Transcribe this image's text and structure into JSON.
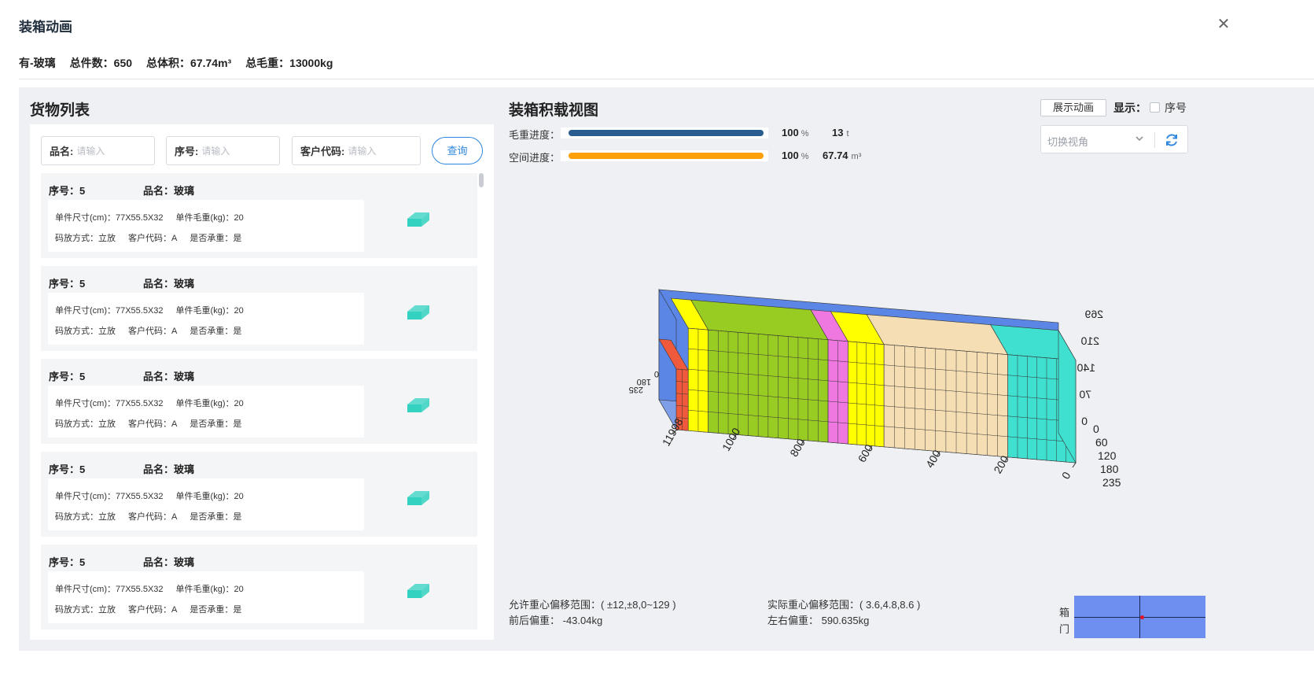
{
  "modal": {
    "title": "装箱动画",
    "close_glyph": "✕"
  },
  "summary": {
    "cargo": "有-玻璃",
    "total_count": "总件数：650",
    "total_volume": "总体积：67.74m³",
    "total_weight": "总毛重：13000kg"
  },
  "cargo_list": {
    "title": "货物列表",
    "filters": [
      {
        "label": "品名:",
        "placeholder": "请输入"
      },
      {
        "label": "序号:",
        "placeholder": "请输入"
      },
      {
        "label": "客户代码:",
        "placeholder": "请输入"
      }
    ],
    "query_label": "查询",
    "items": [
      {
        "seq": "序号：5",
        "name": "品名：玻璃",
        "size": "单件尺寸(cm)：77X55.5X32",
        "weight": "单件毛重(kg)：20",
        "placement": "码放方式：立放",
        "customer": "客户代码：A",
        "bearing": "是否承重：是",
        "icon": "box-icon"
      },
      {
        "seq": "序号：5",
        "name": "品名：玻璃",
        "size": "单件尺寸(cm)：77X55.5X32",
        "weight": "单件毛重(kg)：20",
        "placement": "码放方式：立放",
        "customer": "客户代码：A",
        "bearing": "是否承重：是",
        "icon": "box-icon"
      },
      {
        "seq": "序号：5",
        "name": "品名：玻璃",
        "size": "单件尺寸(cm)：77X55.5X32",
        "weight": "单件毛重(kg)：20",
        "placement": "码放方式：立放",
        "customer": "客户代码：A",
        "bearing": "是否承重：是",
        "icon": "box-icon"
      },
      {
        "seq": "序号：5",
        "name": "品名：玻璃",
        "size": "单件尺寸(cm)：77X55.5X32",
        "weight": "单件毛重(kg)：20",
        "placement": "码放方式：立放",
        "customer": "客户代码：A",
        "bearing": "是否承重：是",
        "icon": "box-icon"
      },
      {
        "seq": "序号：5",
        "name": "品名：玻璃",
        "size": "单件尺寸(cm)：77X55.5X32",
        "weight": "单件毛重(kg)：20",
        "placement": "码放方式：立放",
        "customer": "客户代码：A",
        "bearing": "是否承重：是",
        "icon": "box-icon"
      }
    ],
    "box_color": "#33d1c0"
  },
  "loading_view": {
    "title": "装箱积载视图",
    "weight_progress": {
      "label": "毛重进度：",
      "percent": 100,
      "percent_text": "100",
      "percent_unit": "%",
      "value": "13",
      "unit": "t",
      "color": "#2a5d8f"
    },
    "space_progress": {
      "label": "空间进度：",
      "percent": 100,
      "percent_text": "100",
      "percent_unit": "%",
      "value": "67.74",
      "unit": "m³",
      "color": "#ff9f0a"
    },
    "animate_button": "展示动画",
    "show_label": "显示：",
    "seq_checkbox_label": "序号",
    "seq_checked": false,
    "view_select_placeholder": "切换视角",
    "length_ticks": [
      "0",
      "200",
      "400",
      "600",
      "800",
      "1000",
      "11998"
    ],
    "width_ticks": [
      "0",
      "60",
      "120",
      "180",
      "235"
    ],
    "height_ticks": [
      "0",
      "70",
      "140",
      "210",
      "269"
    ],
    "back_ticks": [
      "235",
      "180",
      "0"
    ],
    "colors": {
      "container": "#5b86e5",
      "red": "#ef5a3c",
      "yellow": "#ffff00",
      "green": "#99cc22",
      "pink": "#ee77e0",
      "tan": "#f5deb3",
      "cyan": "#40e0d0"
    }
  },
  "cog": {
    "allowed_label": "允许重心偏移范围：( ±12,±8,0~129 )",
    "actual_label": "实际重心偏移范围：( 3.6,4.8,8.6 )",
    "front_back": "前后偏重：  -43.04kg",
    "left_right": "左右偏重：  590.635kg",
    "door_top": "箱",
    "door_bottom": "门"
  }
}
